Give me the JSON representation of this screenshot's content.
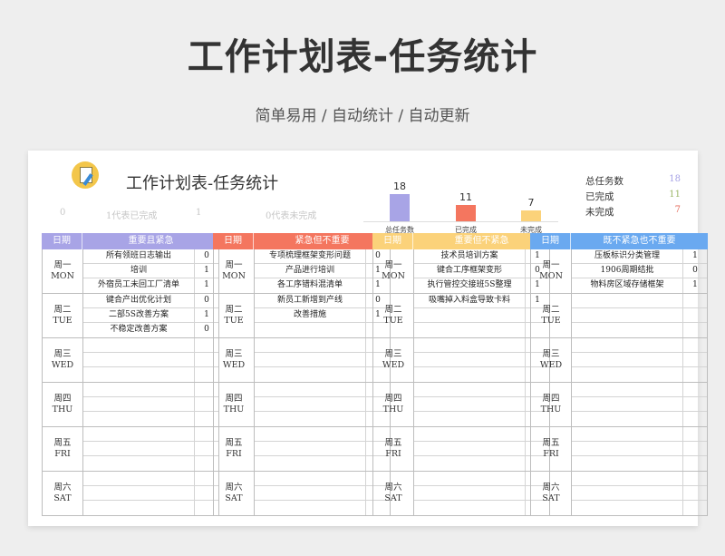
{
  "header": {
    "title": "工作计划表-任务统计",
    "subtitle": "简单易用 / 自动统计 / 自动更新"
  },
  "sheet": {
    "title": "工作计划表-任务统计",
    "stats": {
      "a": "0",
      "b": "1代表已完成",
      "c": "1",
      "d": "0代表未完成"
    },
    "colors": {
      "total": "#a8a4e6",
      "done": "#f4765f",
      "pending": "#fbd27a"
    }
  },
  "chart_data": {
    "type": "bar",
    "categories": [
      "总任务数",
      "已完成",
      "未完成"
    ],
    "values": [
      18,
      11,
      7
    ],
    "ylim": [
      0,
      18
    ]
  },
  "summary": [
    {
      "label": "总任务数",
      "value": "18",
      "color": "#a8a4e6"
    },
    {
      "label": "已完成",
      "value": "11",
      "color": "#9db86a"
    },
    {
      "label": "未完成",
      "value": "7",
      "color": "#e46a5a"
    }
  ],
  "days": [
    {
      "cn": "周一",
      "en": "MON"
    },
    {
      "cn": "周二",
      "en": "TUE"
    },
    {
      "cn": "周三",
      "en": "WED"
    },
    {
      "cn": "周四",
      "en": "THU"
    },
    {
      "cn": "周五",
      "en": "FRI"
    },
    {
      "cn": "周六",
      "en": "SAT"
    }
  ],
  "panels": [
    {
      "date_label": "日期",
      "header": "重要且紧急",
      "color": "#a8a4e6",
      "days": [
        [
          {
            "task": "所有领班日志输出",
            "status": "0"
          },
          {
            "task": "培训",
            "status": "1"
          },
          {
            "task": "外宿员工未回工厂清单",
            "status": "1"
          }
        ],
        [
          {
            "task": "键合产出优化计划",
            "status": "0"
          },
          {
            "task": "二部5S改善方案",
            "status": "1"
          },
          {
            "task": "不稳定改善方案",
            "status": "0"
          }
        ],
        [],
        [],
        [],
        []
      ]
    },
    {
      "date_label": "日期",
      "header": "紧急但不重要",
      "color": "#f4765f",
      "days": [
        [
          {
            "task": "专项梳理框架变形问题",
            "status": "0"
          },
          {
            "task": "产品进行培训",
            "status": "1"
          },
          {
            "task": "各工序错料混清单",
            "status": "1"
          }
        ],
        [
          {
            "task": "新员工新增到产线",
            "status": "0"
          },
          {
            "task": "改善措施",
            "status": "1"
          }
        ],
        [],
        [],
        [],
        []
      ]
    },
    {
      "date_label": "日期",
      "header": "重要但不紧急",
      "color": "#fbd27a",
      "days": [
        [
          {
            "task": "技术员培训方案",
            "status": "1"
          },
          {
            "task": "键合工序框架变形",
            "status": "0"
          },
          {
            "task": "执行管控交接班5S整理",
            "status": "1"
          }
        ],
        [
          {
            "task": "吸嘴掉入料盒导致卡料",
            "status": "1"
          }
        ],
        [],
        [],
        [],
        []
      ]
    },
    {
      "date_label": "日期",
      "header": "既不紧急也不重要",
      "color": "#6aa9f0",
      "days": [
        [
          {
            "task": "压板标识分类管理",
            "status": "1"
          },
          {
            "task": "1906周期结批",
            "status": "0"
          },
          {
            "task": "物料房区域存储框架",
            "status": "1"
          }
        ],
        [],
        [],
        [],
        [],
        []
      ]
    }
  ]
}
